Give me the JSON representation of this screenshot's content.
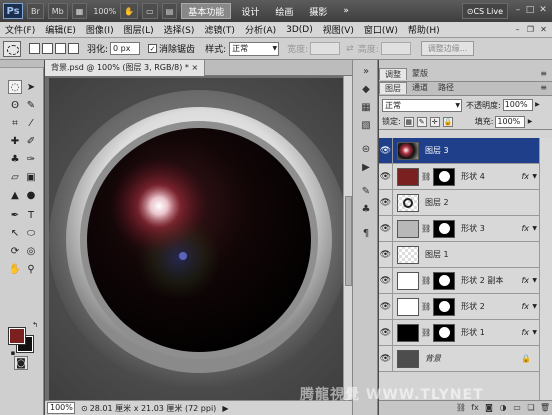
{
  "titlebar": {
    "logo": "Ps",
    "mb_label": "Mb",
    "zoom": "100%",
    "workspaces": [
      "基本功能",
      "设计",
      "绘画",
      "摄影"
    ],
    "cs_live": "CS Live"
  },
  "menu": [
    "文件(F)",
    "编辑(E)",
    "图像(I)",
    "图层(L)",
    "选择(S)",
    "滤镜(T)",
    "分析(A)",
    "3D(D)",
    "视图(V)",
    "窗口(W)",
    "帮助(H)"
  ],
  "options": {
    "feather_label": "羽化:",
    "feather_value": "0 px",
    "antialias_label": "消除锯齿",
    "style_label": "样式:",
    "style_value": "正常",
    "width_label": "宽度:",
    "height_label": "高度:",
    "refine_edge": "调整边缘..."
  },
  "document": {
    "tab_label": "背景.psd @ 100% (图层 3, RGB/8) *",
    "zoom": "100%",
    "info": "28.01 厘米 x 21.03 厘米 (72 ppi)"
  },
  "panels": {
    "top_tabs": [
      "调整",
      "蒙版"
    ],
    "layer_tabs": [
      "图层",
      "通道",
      "路径"
    ],
    "blend_mode": "正常",
    "opacity_label": "不透明度:",
    "opacity_value": "100%",
    "lock_label": "锁定:",
    "fill_label": "填充:",
    "fill_value": "100%"
  },
  "layers": [
    {
      "name": "图层 3",
      "selected": true,
      "type": "pixel"
    },
    {
      "name": "形状 4",
      "selected": false,
      "type": "shape",
      "thumb_color": "#7a2020"
    },
    {
      "name": "图层 2",
      "selected": false,
      "type": "pixel"
    },
    {
      "name": "形状 3",
      "selected": false,
      "type": "shape",
      "thumb_color": "#b8b8b8"
    },
    {
      "name": "图层 1",
      "selected": false,
      "type": "pixel"
    },
    {
      "name": "形状 2 副本",
      "selected": false,
      "type": "shape",
      "thumb_color": "#ffffff"
    },
    {
      "name": "形状 2",
      "selected": false,
      "type": "shape",
      "thumb_color": "#ffffff"
    },
    {
      "name": "形状 1",
      "selected": false,
      "type": "shape",
      "thumb_color": "#000000"
    },
    {
      "name": "背景",
      "selected": false,
      "type": "background"
    }
  ],
  "fx_label": "fx",
  "watermark": "腾龍視覺 WWW.TLYNET"
}
